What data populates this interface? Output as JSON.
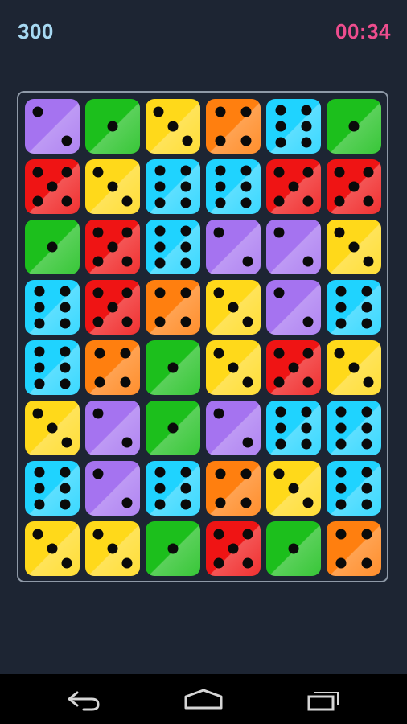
{
  "hud": {
    "score": "300",
    "timer": "00:34"
  },
  "colors": {
    "background": "#1d2533",
    "score": "#a7d9f2",
    "timer": "#ee4d8e",
    "purple": "#a573f0",
    "green": "#1cbf1c",
    "yellow": "#ffd91a",
    "orange": "#ff7f0f",
    "cyan": "#1fd3ff",
    "red": "#ef1414"
  },
  "board": {
    "rows": [
      [
        {
          "color": "purple",
          "value": 2
        },
        {
          "color": "green",
          "value": 1
        },
        {
          "color": "yellow",
          "value": 3
        },
        {
          "color": "orange",
          "value": 4
        },
        {
          "color": "cyan",
          "value": 6
        },
        {
          "color": "green",
          "value": 1
        }
      ],
      [
        {
          "color": "red",
          "value": 5
        },
        {
          "color": "yellow",
          "value": 3
        },
        {
          "color": "cyan",
          "value": 6
        },
        {
          "color": "cyan",
          "value": 6
        },
        {
          "color": "red",
          "value": 5
        },
        {
          "color": "red",
          "value": 5
        }
      ],
      [
        {
          "color": "green",
          "value": 1
        },
        {
          "color": "red",
          "value": 5
        },
        {
          "color": "cyan",
          "value": 6
        },
        {
          "color": "purple",
          "value": 2
        },
        {
          "color": "purple",
          "value": 2
        },
        {
          "color": "yellow",
          "value": 3
        }
      ],
      [
        {
          "color": "cyan",
          "value": 6
        },
        {
          "color": "red",
          "value": 5
        },
        {
          "color": "orange",
          "value": 4
        },
        {
          "color": "yellow",
          "value": 3
        },
        {
          "color": "purple",
          "value": 2
        },
        {
          "color": "cyan",
          "value": 6
        }
      ],
      [
        {
          "color": "cyan",
          "value": 6
        },
        {
          "color": "orange",
          "value": 4
        },
        {
          "color": "green",
          "value": 1
        },
        {
          "color": "yellow",
          "value": 3
        },
        {
          "color": "red",
          "value": 5
        },
        {
          "color": "yellow",
          "value": 3
        }
      ],
      [
        {
          "color": "yellow",
          "value": 3
        },
        {
          "color": "purple",
          "value": 2
        },
        {
          "color": "green",
          "value": 1
        },
        {
          "color": "purple",
          "value": 2
        },
        {
          "color": "cyan",
          "value": 6
        },
        {
          "color": "cyan",
          "value": 6
        }
      ],
      [
        {
          "color": "cyan",
          "value": 6
        },
        {
          "color": "purple",
          "value": 2
        },
        {
          "color": "cyan",
          "value": 6
        },
        {
          "color": "orange",
          "value": 4
        },
        {
          "color": "yellow",
          "value": 3
        },
        {
          "color": "cyan",
          "value": 6
        }
      ],
      [
        {
          "color": "yellow",
          "value": 3
        },
        {
          "color": "yellow",
          "value": 3
        },
        {
          "color": "green",
          "value": 1
        },
        {
          "color": "red",
          "value": 5
        },
        {
          "color": "green",
          "value": 1
        },
        {
          "color": "orange",
          "value": 4
        }
      ]
    ]
  },
  "navbar": {
    "buttons": [
      {
        "icon": "back-icon"
      },
      {
        "icon": "home-icon"
      },
      {
        "icon": "recent-apps-icon"
      }
    ]
  }
}
